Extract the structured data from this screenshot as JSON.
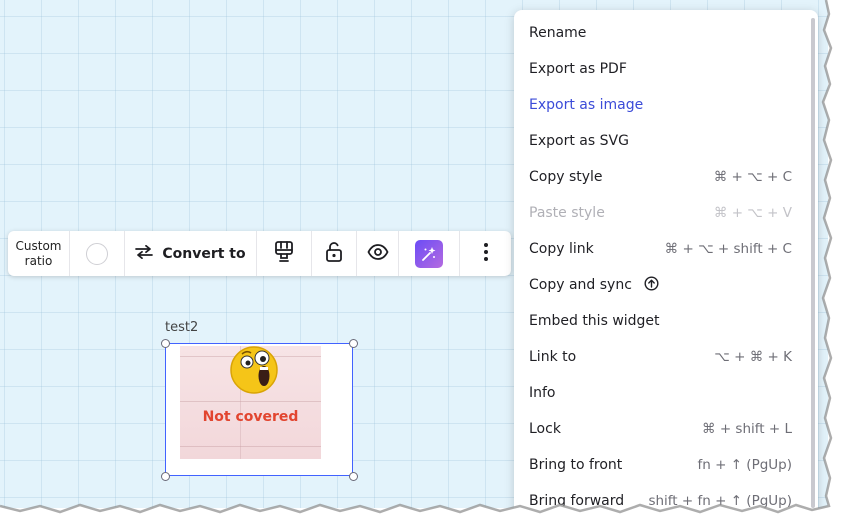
{
  "toolbar": {
    "ratio_line1": "Custom",
    "ratio_line2": "ratio",
    "convert_label": "Convert to",
    "icons": [
      "swap-arrows-icon",
      "stamp-icon",
      "unlock-icon",
      "eye-icon",
      "ai-sparkle-icon",
      "more-vertical-icon"
    ]
  },
  "widget": {
    "title": "test2",
    "image_text": "Not covered",
    "image_icon": "shocked-emoji-icon"
  },
  "menu": {
    "items": [
      {
        "label": "Rename",
        "shortcut": "",
        "state": "normal"
      },
      {
        "label": "Export as PDF",
        "shortcut": "",
        "state": "normal"
      },
      {
        "label": "Export as image",
        "shortcut": "",
        "state": "active"
      },
      {
        "label": "Export as SVG",
        "shortcut": "",
        "state": "normal"
      },
      {
        "label": "Copy style",
        "shortcut": "⌘ + ⌥ + C",
        "state": "normal"
      },
      {
        "label": "Paste style",
        "shortcut": "⌘ + ⌥ + V",
        "state": "disabled"
      },
      {
        "label": "Copy link",
        "shortcut": "⌘ + ⌥ + shift + C",
        "state": "normal"
      },
      {
        "label": "Copy and sync",
        "shortcut": "",
        "state": "normal",
        "icon": "upgrade-arrow-icon"
      },
      {
        "label": "Embed this widget",
        "shortcut": "",
        "state": "normal"
      },
      {
        "label": "Link to",
        "shortcut": "⌥ + ⌘ + K",
        "state": "normal"
      },
      {
        "label": "Info",
        "shortcut": "",
        "state": "normal"
      },
      {
        "label": "Lock",
        "shortcut": "⌘ + shift + L",
        "state": "normal"
      },
      {
        "label": "Bring to front",
        "shortcut": "fn + ↑ (PgUp)",
        "state": "normal"
      },
      {
        "label": "Bring forward",
        "shortcut": "shift + fn + ↑ (PgUp)",
        "state": "normal"
      }
    ]
  },
  "colors": {
    "canvas_bg": "#e3f3fb",
    "accent": "#3b4bd8",
    "selection": "#4262ff",
    "image_text": "#e2452f"
  }
}
